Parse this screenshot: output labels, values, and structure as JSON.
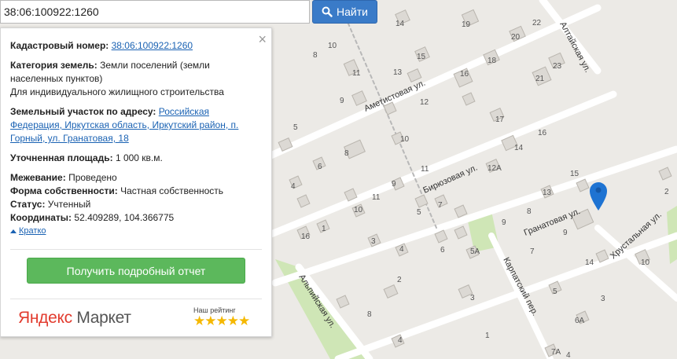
{
  "search": {
    "value": "38:06:100922:1260",
    "button_label": "Найти"
  },
  "panel": {
    "close_label": "×",
    "cadastral_label": "Кадастровый номер:",
    "cadastral_value": "38:06:100922:1260",
    "category_label": "Категория земель:",
    "category_value_1": "Земли поселений (земли",
    "category_value_2": "населенных пунктов)",
    "usage": "Для индивидуального жилищного строительства",
    "address_label": "Земельный участок по адресу:",
    "address_line_1": "Российская",
    "address_line_2": "Федерация, Иркутская область, Иркутский район, п.",
    "address_line_3": "Горный, ул. Гранатовая, 18",
    "area_label": "Уточненная площадь:",
    "area_value": "1 000 кв.м.",
    "survey_label": "Межевание:",
    "survey_value": "Проведено",
    "ownership_label": "Форма собственности:",
    "ownership_value": "Частная собственность",
    "status_label": "Статус:",
    "status_value": "Учтенный",
    "coords_label": "Координаты:",
    "coords_value": "52.409289, 104.366775",
    "collapse_label": "Кратко",
    "report_button": "Получить подробный отчет",
    "market_logo_1": "Яндекс",
    "market_logo_2": "Маркет",
    "rating_label": "Наш рейтинг",
    "rating_stars": 5,
    "stars_text": "★★★★★"
  },
  "map": {
    "streets": [
      "Аметистовая ул.",
      "Бирюзовая ул.",
      "Гранатовая ул.",
      "Алтайская ул.",
      "Альпийская ул.",
      "Карпатский пер.",
      "Хрустальная ул."
    ],
    "house_numbers": [
      "14",
      "19",
      "20",
      "22",
      "10",
      "8",
      "15",
      "18",
      "23",
      "11",
      "13",
      "16",
      "21",
      "9",
      "12",
      "5",
      "17",
      "10",
      "16",
      "8",
      "14",
      "6",
      "11",
      "12А",
      "15",
      "4",
      "9",
      "13",
      "11",
      "7",
      "10",
      "9",
      "5",
      "8",
      "9",
      "16",
      "1",
      "3",
      "4",
      "6",
      "5А",
      "7",
      "14",
      "5",
      "2",
      "3",
      "10",
      "3",
      "8",
      "6А",
      "1",
      "4",
      "7А",
      "4",
      "2",
      "9"
    ],
    "pin_color": "#1e73d2"
  },
  "colors": {
    "accent": "#3a7bc8",
    "report": "#5cb85c",
    "link": "#1a62b3"
  }
}
